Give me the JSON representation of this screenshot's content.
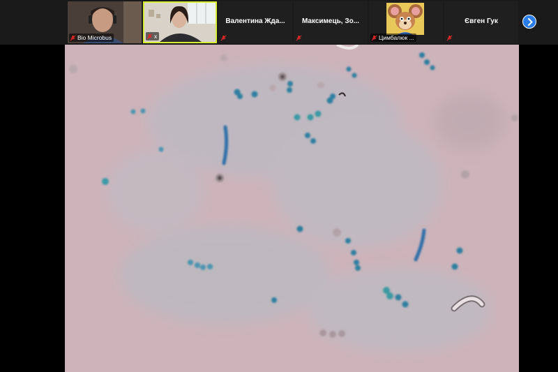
{
  "participants": [
    {
      "name": "Bio Microbus",
      "type": "video",
      "muted": true
    },
    {
      "name": "x",
      "type": "video",
      "muted": true,
      "active": true
    },
    {
      "name": "Валентина Жда...",
      "type": "name",
      "muted": true
    },
    {
      "name": "Максимець, Зо...",
      "type": "name",
      "muted": true
    },
    {
      "name": "Цимбалюк ...",
      "type": "avatar",
      "muted": true
    },
    {
      "name": "Євген Гук",
      "type": "name",
      "muted": true
    }
  ],
  "colors": {
    "strip_background": "#1a1a1a",
    "active_speaker_border": "#d7ee34",
    "next_button": "#2b7de9",
    "muted_icon": "#e02828",
    "microscope_background": "#cdb3ba",
    "stained_bacteria": "#2e7fa0"
  },
  "icons": {
    "mic": "mic-muted-icon",
    "next": "chevron-right-icon"
  },
  "shared_screen": {
    "content": "microscope-slide"
  }
}
